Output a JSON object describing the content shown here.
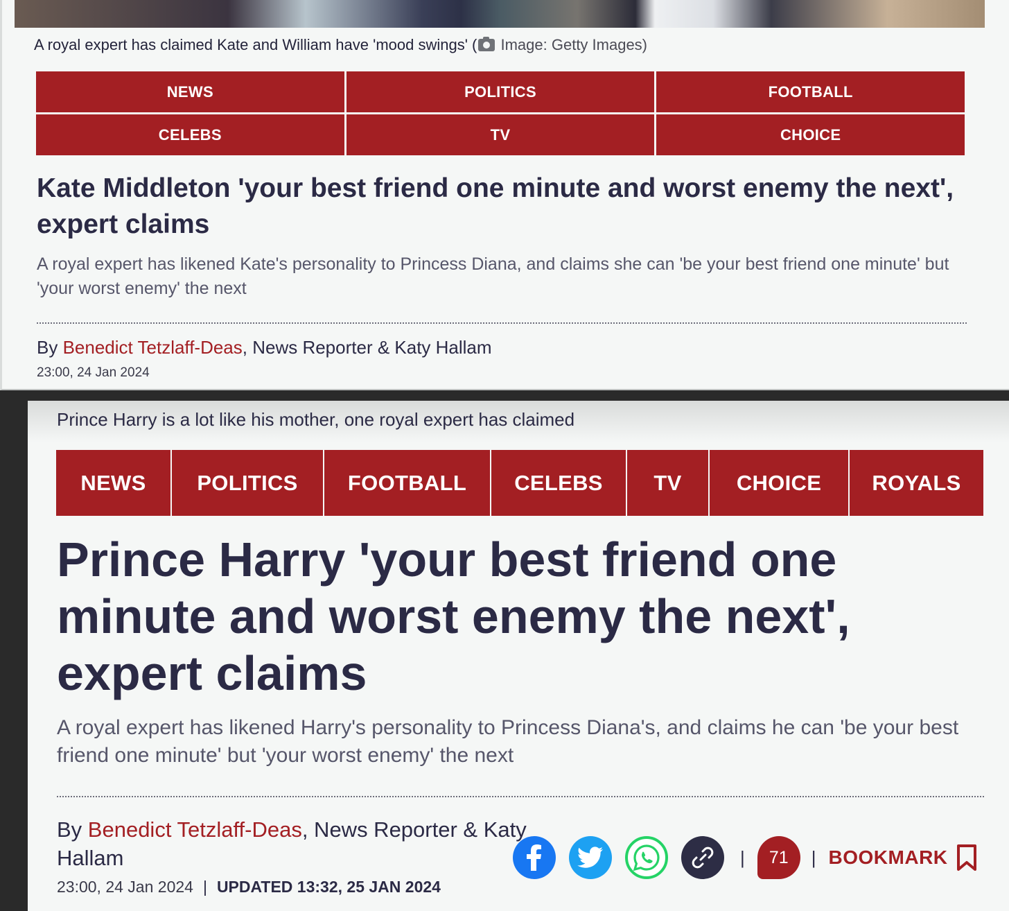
{
  "top": {
    "caption": "A royal expert has claimed Kate and William have 'mood swings' (",
    "caption_credit": "Image: Getty Images)",
    "nav": [
      "NEWS",
      "POLITICS",
      "FOOTBALL",
      "CELEBS",
      "TV",
      "CHOICE"
    ],
    "headline": "Kate Middleton 'your best friend one minute and worst enemy the next', expert claims",
    "standfirst": "A royal expert has likened Kate's personality to Princess Diana, and claims she can 'be your best friend one minute' but 'your worst enemy' the next",
    "byline_prefix": "By ",
    "author": "Benedict Tetzlaff-Deas",
    "byline_rest": ", News Reporter &  Katy Hallam",
    "date": "23:00, 24 Jan 2024"
  },
  "bottom": {
    "caption": "Prince Harry is a lot like his mother, one royal expert has claimed",
    "nav": [
      "NEWS",
      "POLITICS",
      "FOOTBALL",
      "CELEBS",
      "TV",
      "CHOICE",
      "ROYALS"
    ],
    "headline": "Prince Harry 'your best friend one minute and worst enemy the next', expert claims",
    "standfirst": "A royal expert has likened Harry's personality to Princess Diana's, and claims he can 'be your best friend one minute' but 'your worst enemy' the next",
    "byline_prefix": "By ",
    "author": "Benedict Tetzlaff-Deas",
    "byline_rest": ", News Reporter & Katy Hallam",
    "date": "23:00, 24 Jan 2024",
    "separator": "|",
    "updated": "UPDATED 13:32, 25 JAN 2024",
    "share_icons": [
      "facebook-icon",
      "twitter-icon",
      "whatsapp-icon",
      "link-icon"
    ],
    "comment_count": "71",
    "bookmark_label": "BOOKMARK"
  },
  "colors": {
    "accent": "#a31f23",
    "heading": "#2b2a45",
    "body_text": "#56566a"
  }
}
